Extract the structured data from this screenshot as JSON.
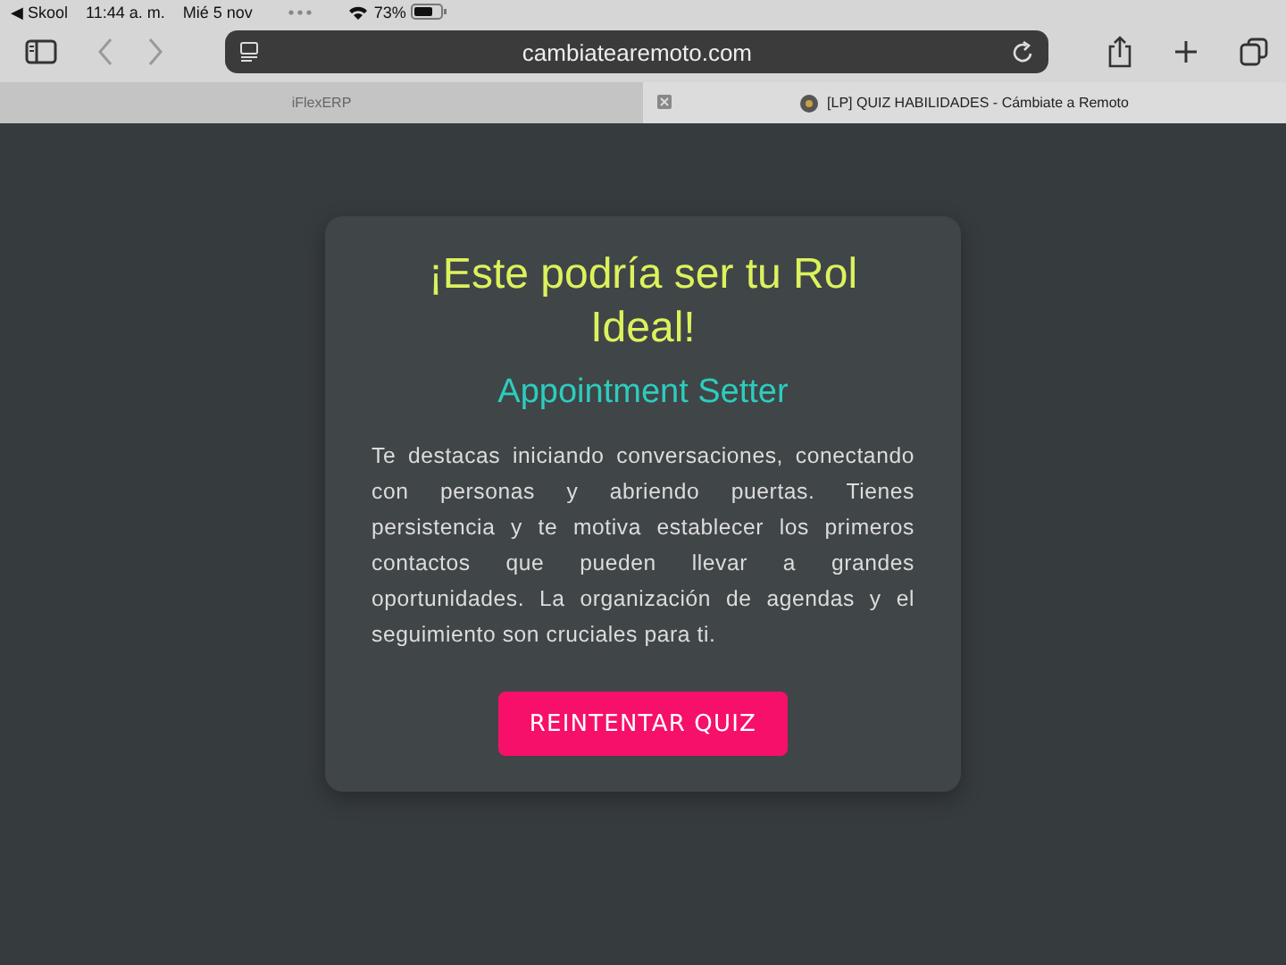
{
  "status_bar": {
    "back_app": "◀ Skool",
    "time": "11:44 a. m.",
    "date": "Mié 5 nov",
    "battery": "73%"
  },
  "address_bar": {
    "url": "cambiatearemoto.com"
  },
  "tabs": [
    {
      "label": "iFlexERP",
      "selected": false
    },
    {
      "label": "[LP] QUIZ HABILIDADES - Cámbiate a Remoto",
      "selected": true
    }
  ],
  "result_card": {
    "title": "¡Este podría ser tu Rol Ideal!",
    "role": "Appointment Setter",
    "description": "Te destacas iniciando conversaciones, conectando con personas y abriendo puertas. Tienes persistencia y te motiva establecer los primeros contactos que pueden llevar a grandes oportunidades. La organización de agendas y el seguimiento son cruciales para ti.",
    "button": "REINTENTAR QUIZ"
  }
}
